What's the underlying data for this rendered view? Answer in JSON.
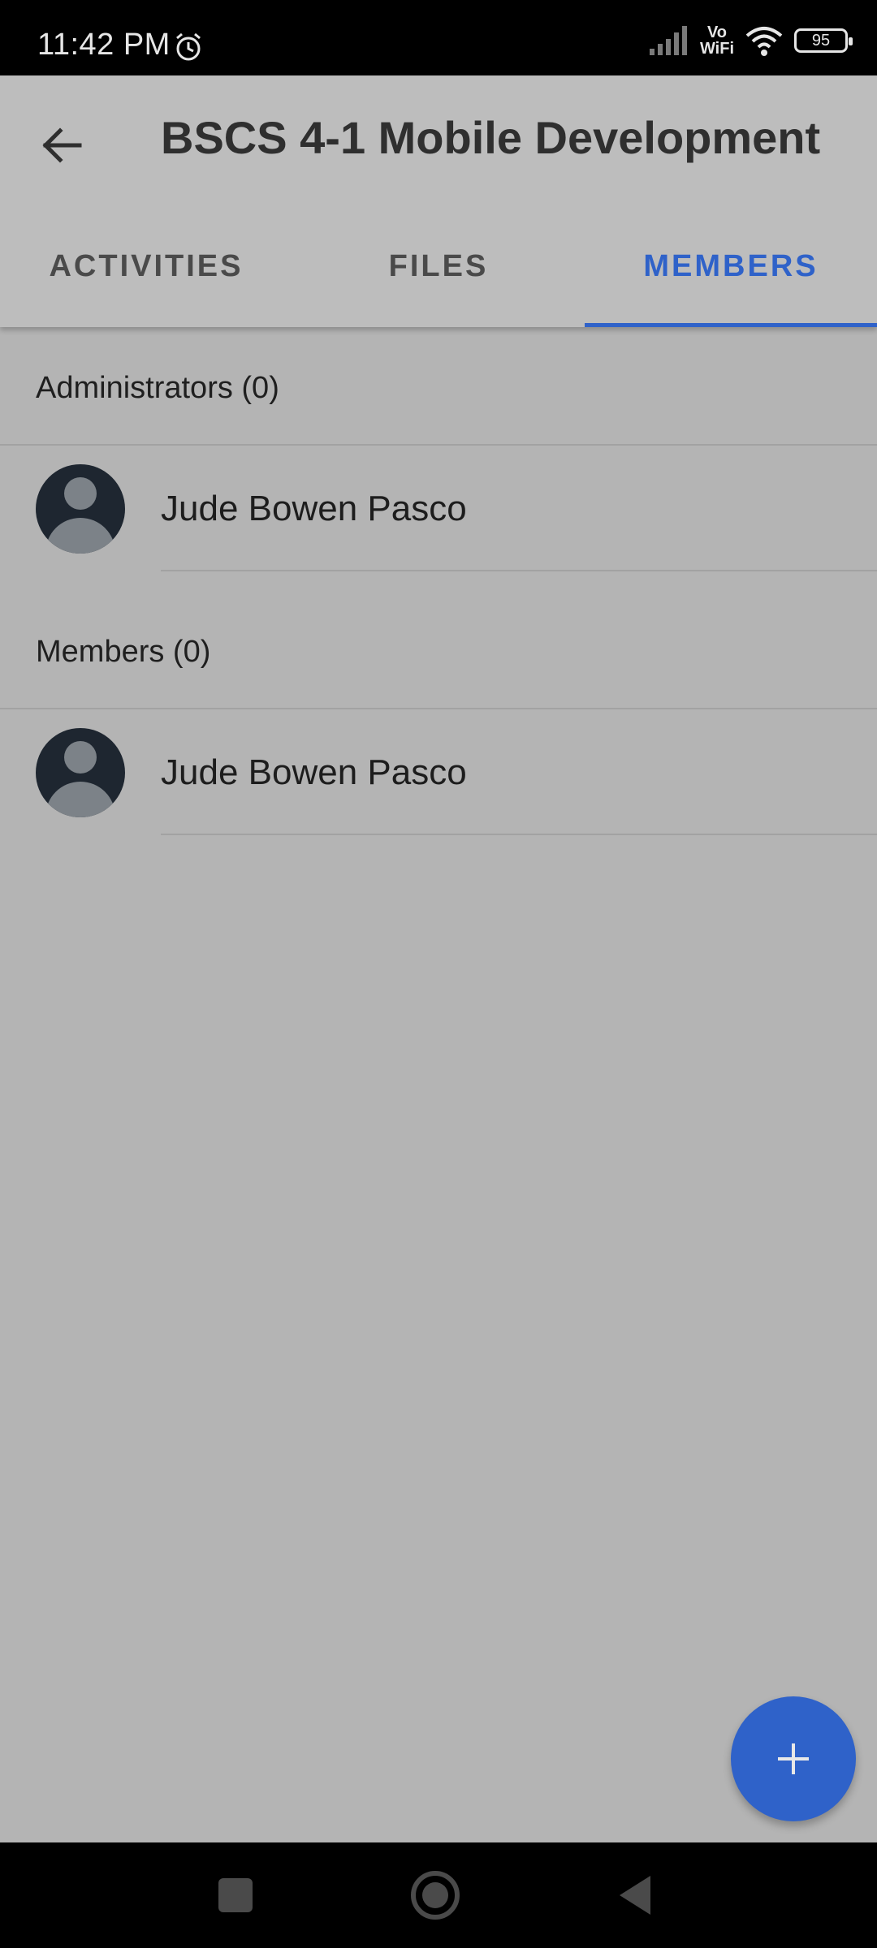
{
  "status_bar": {
    "time": "11:42 PM",
    "alarm_icon": "alarm-clock-icon",
    "signal_icon": "cellular-signal-icon",
    "vowifi_top": "Vo",
    "vowifi_bottom": "WiFi",
    "wifi_icon": "wifi-icon",
    "battery": "95"
  },
  "app_bar": {
    "back_icon": "arrow-back-icon",
    "title": "BSCS 4-1 Mobile Development"
  },
  "tabs": [
    {
      "label": "ACTIVITIES",
      "active": false
    },
    {
      "label": "FILES",
      "active": false
    },
    {
      "label": "MEMBERS",
      "active": true
    }
  ],
  "sections": [
    {
      "header": "Administrators (0)",
      "members": [
        {
          "name": "Jude Bowen Pasco",
          "avatar_icon": "person-avatar-icon"
        }
      ]
    },
    {
      "header": "Members (0)",
      "members": [
        {
          "name": "Jude Bowen Pasco",
          "avatar_icon": "person-avatar-icon"
        }
      ]
    }
  ],
  "fab": {
    "icon": "plus-icon"
  },
  "nav_bar": {
    "recents_icon": "square-recents-icon",
    "home_icon": "circle-home-icon",
    "back_icon": "triangle-back-icon"
  },
  "colors": {
    "accent": "#2f62c9",
    "background": "#b4b4b4",
    "app_bar": "#bdbdbd"
  }
}
